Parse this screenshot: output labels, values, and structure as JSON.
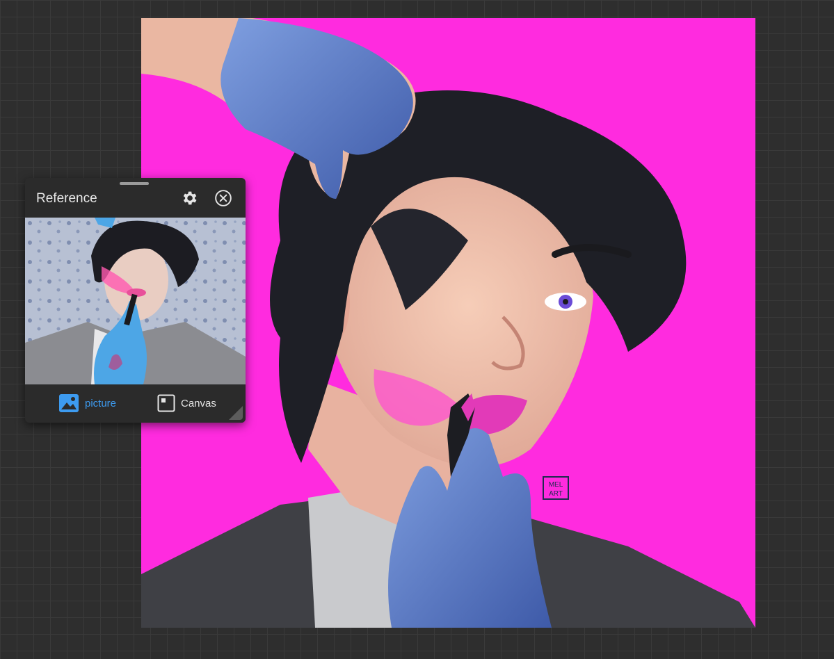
{
  "canvas": {
    "background_color": "#ff2bdf",
    "signature_text": "MEL ART"
  },
  "reference_panel": {
    "title": "Reference",
    "settings_icon": "gear-icon",
    "close_icon": "close-circle-icon",
    "tabs": [
      {
        "label": "picture",
        "icon": "image-icon",
        "active": true,
        "color": "#3d9bf0"
      },
      {
        "label": "Canvas",
        "icon": "canvas-icon",
        "active": false,
        "color": "#e6e6e6"
      }
    ]
  }
}
